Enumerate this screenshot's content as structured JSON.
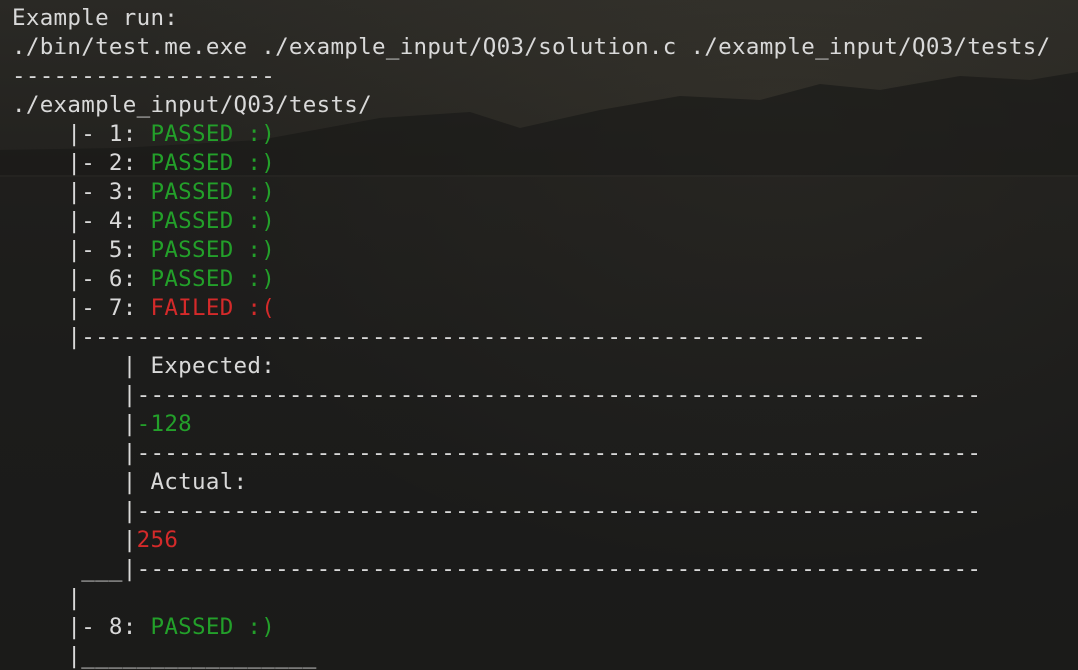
{
  "colors": {
    "default_text": "#d9d9d9",
    "pass": "#23a02a",
    "fail": "#d42a2a",
    "background": "#1f1f1d"
  },
  "terminal": {
    "lines": [
      [
        {
          "text": "Example run:",
          "kind": "default"
        }
      ],
      [
        {
          "text": "./bin/test.me.exe ./example_input/Q03/solution.c ./example_input/Q03/tests/",
          "kind": "default"
        }
      ],
      [
        {
          "text": "-------------------",
          "kind": "default"
        }
      ],
      [
        {
          "text": "./example_input/Q03/tests/",
          "kind": "default"
        }
      ],
      [
        {
          "text": "    |- 1: ",
          "kind": "default"
        },
        {
          "text": "PASSED :)",
          "kind": "pass"
        }
      ],
      [
        {
          "text": "    |- 2: ",
          "kind": "default"
        },
        {
          "text": "PASSED :)",
          "kind": "pass"
        }
      ],
      [
        {
          "text": "    |- 3: ",
          "kind": "default"
        },
        {
          "text": "PASSED :)",
          "kind": "pass"
        }
      ],
      [
        {
          "text": "    |- 4: ",
          "kind": "default"
        },
        {
          "text": "PASSED :)",
          "kind": "pass"
        }
      ],
      [
        {
          "text": "    |- 5: ",
          "kind": "default"
        },
        {
          "text": "PASSED :)",
          "kind": "pass"
        }
      ],
      [
        {
          "text": "    |- 6: ",
          "kind": "default"
        },
        {
          "text": "PASSED :)",
          "kind": "pass"
        }
      ],
      [
        {
          "text": "    |- 7: ",
          "kind": "default"
        },
        {
          "text": "FAILED :(",
          "kind": "fail"
        }
      ],
      [
        {
          "text": "    |-------------------------------------------------------------",
          "kind": "default"
        }
      ],
      [
        {
          "text": "        | Expected:",
          "kind": "default"
        }
      ],
      [
        {
          "text": "        |-------------------------------------------------------------",
          "kind": "default"
        }
      ],
      [
        {
          "text": "        |",
          "kind": "default"
        },
        {
          "text": "-128",
          "kind": "pass"
        }
      ],
      [
        {
          "text": "        |-------------------------------------------------------------",
          "kind": "default"
        }
      ],
      [
        {
          "text": "        | Actual:",
          "kind": "default"
        }
      ],
      [
        {
          "text": "        |-------------------------------------------------------------",
          "kind": "default"
        }
      ],
      [
        {
          "text": "        |",
          "kind": "default"
        },
        {
          "text": "256",
          "kind": "fail"
        }
      ],
      [
        {
          "text": "     ___|-------------------------------------------------------------",
          "kind": "default"
        }
      ],
      [
        {
          "text": "    |",
          "kind": "default"
        }
      ],
      [
        {
          "text": "    |- 8: ",
          "kind": "default"
        },
        {
          "text": "PASSED :)",
          "kind": "pass"
        }
      ],
      [
        {
          "text": "    |_________________",
          "kind": "default"
        }
      ]
    ]
  }
}
